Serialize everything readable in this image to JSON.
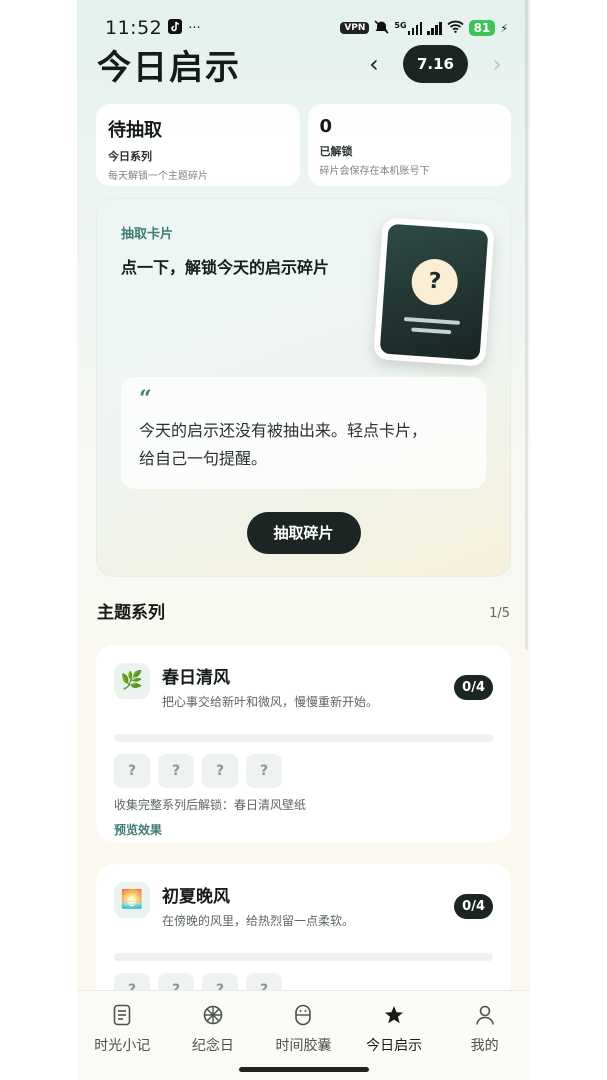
{
  "status_bar": {
    "time": "11:52",
    "more": "···",
    "vpn": "VPN",
    "net": "5G",
    "battery": "81"
  },
  "header": {
    "title": "今日启示",
    "prev": "‹",
    "next": "›",
    "date": "7.16"
  },
  "stats": [
    {
      "value": "待抽取",
      "label": "今日系列",
      "sub": "每天解锁一个主题碎片"
    },
    {
      "value": "0",
      "label": "已解锁",
      "sub": "碎片会保存在本机账号下"
    }
  ],
  "draw_card": {
    "kicker": "抽取卡片",
    "title": "点一下，解锁今天的启示碎片",
    "card_symbol": "?",
    "quote_mark": "“",
    "quote_line1": "今天的启示还没有被抽出来。轻点卡片，",
    "quote_line2": "给自己一句提醒。",
    "button": "抽取碎片"
  },
  "series_section": {
    "title": "主题系列",
    "count": "1/5"
  },
  "series": [
    {
      "icon": "🌿",
      "icon_name": "leaf-icon",
      "name": "春日清风",
      "desc": "把心事交给新叶和微风，慢慢重新开始。",
      "progress": "0/4",
      "progress_fraction": 0,
      "slots": [
        "?",
        "?",
        "?",
        "?"
      ],
      "unlock": "收集完整系列后解锁：春日清风壁纸",
      "preview": "预览效果"
    },
    {
      "icon": "🌅",
      "icon_name": "sunset-icon",
      "name": "初夏晚风",
      "desc": "在傍晚的风里，给热烈留一点柔软。",
      "progress": "0/4",
      "progress_fraction": 0,
      "slots": [
        "?",
        "?",
        "?",
        "?"
      ]
    }
  ],
  "tabs": [
    {
      "label": "时光小记",
      "icon": "journal-icon"
    },
    {
      "label": "纪念日",
      "icon": "wheel-icon"
    },
    {
      "label": "时间胶囊",
      "icon": "capsule-icon"
    },
    {
      "label": "今日启示",
      "icon": "star-icon",
      "active": true
    },
    {
      "label": "我的",
      "icon": "profile-icon"
    }
  ],
  "colors": {
    "accent": "#3f7d74",
    "dark": "#1b2523",
    "background": "#edf5f1"
  }
}
